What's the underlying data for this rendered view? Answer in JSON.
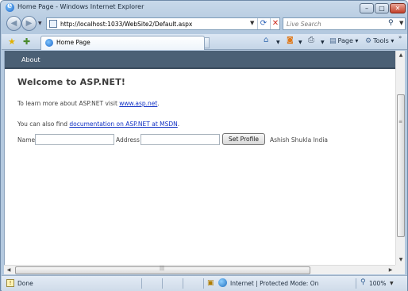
{
  "window": {
    "title": "Home Page - Windows Internet Explorer",
    "min_glyph": "–",
    "max_glyph": "□",
    "close_glyph": "✕"
  },
  "navigation": {
    "back_glyph": "◀",
    "forward_glyph": "▶",
    "address_url": "http://localhost:1033/WebSite2/Default.aspx",
    "search_placeholder": "Live Search"
  },
  "tabs": [
    {
      "label": "Home Page"
    }
  ],
  "command_bar": {
    "page_label": "Page",
    "tools_label": "Tools"
  },
  "site": {
    "menu": [
      {
        "label": "About"
      }
    ],
    "heading": "Welcome to ASP.NET!",
    "para1_prefix": "To learn more about ASP.NET visit ",
    "para1_link": "www.asp.net",
    "para1_suffix": ".",
    "para2_prefix": "You can also find ",
    "para2_link": "documentation on ASP.NET at MSDN",
    "para2_suffix": ".",
    "form": {
      "name_label": "Name",
      "name_value": "",
      "address_label": "Address",
      "address_value": "",
      "button_label": "Set Profile",
      "output_text": "Ashish Shukla India"
    }
  },
  "status": {
    "text": "Done",
    "zone": "Internet | Protected Mode: On",
    "zoom": "100%"
  },
  "icons": {
    "favorites": "favorites-star-icon",
    "add_favorites": "add-favorites-icon",
    "home": "home-icon",
    "feeds": "rss-feeds-icon",
    "print": "printer-icon",
    "page": "page-icon",
    "tools": "tools-gear-icon",
    "search": "magnifier-icon",
    "refresh": "refresh-icon",
    "stop": "stop-icon",
    "globe": "internet-zone-globe-icon"
  }
}
